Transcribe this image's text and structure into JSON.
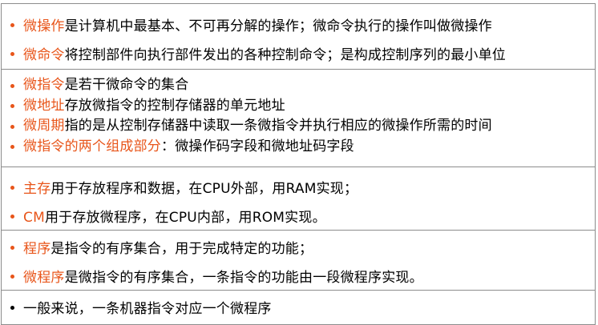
{
  "colors": {
    "highlight": "#e8551a",
    "border": "#8c8c8c",
    "text": "#000000"
  },
  "rows": [
    {
      "lines": [
        {
          "term": "微操作",
          "rest": "是计算机中最基本、不可再分解的操作；微命令执行的操作叫做微操作"
        },
        {
          "term": "微命令",
          "rest": "将控制部件向执行部件发出的各种控制命令；是构成控制序列的最小单位"
        }
      ]
    },
    {
      "lines": [
        {
          "term": "微指令",
          "rest": "是若干微命令的集合"
        },
        {
          "term": "微地址",
          "rest": "存放微指令的控制存储器的单元地址"
        },
        {
          "term": "微周期",
          "rest": "指的是从控制存储器中读取一条微指令并执行相应的微操作所需的时间"
        },
        {
          "term": "微指令的两个组成部分",
          "rest": "：微操作码字段和微地址码字段"
        }
      ]
    },
    {
      "lines": [
        {
          "term": "主存",
          "rest": "用于存放程序和数据，在CPU外部，用RAM实现；"
        },
        {
          "term": "CM",
          "rest": "用于存放微程序，在CPU内部，用ROM实现。"
        }
      ]
    },
    {
      "lines": [
        {
          "term": "程序",
          "rest": "是指令的有序集合，用于完成特定的功能；"
        },
        {
          "term": "微程序",
          "rest": "是微指令的有序集合，一条指令的功能由一段微程序实现。"
        }
      ]
    },
    {
      "lines": [
        {
          "term": "",
          "rest": "一般来说，一条机器指令对应一个微程序"
        }
      ]
    }
  ]
}
